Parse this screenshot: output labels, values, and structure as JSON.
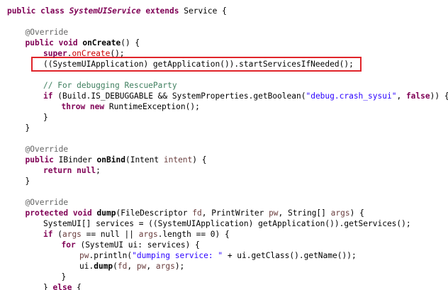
{
  "editor": {
    "language": "java",
    "colors": {
      "keyword": "#7f0055",
      "annotation": "#646464",
      "string": "#2a00ff",
      "comment": "#3f7f5f",
      "local_variable": "#6a3e3e",
      "highlight_box": "#e0242a"
    },
    "lines": [
      {
        "id": "l1",
        "indent": 0,
        "tokens": [
          {
            "t": "public class ",
            "c": "kw"
          },
          {
            "t": "SystemUIService",
            "c": "cls"
          },
          {
            "t": " extends ",
            "c": "kw"
          },
          {
            "t": "Service {",
            "c": "plain"
          }
        ]
      },
      {
        "id": "l3",
        "indent": 1,
        "tokens": [
          {
            "t": "@Override",
            "c": "ann"
          }
        ]
      },
      {
        "id": "l4",
        "indent": 1,
        "tokens": [
          {
            "t": "public void ",
            "c": "kw"
          },
          {
            "t": "onCreate",
            "c": "fn"
          },
          {
            "t": "() {",
            "c": "plain"
          }
        ]
      },
      {
        "id": "l5",
        "indent": 2,
        "tokens": [
          {
            "t": "super",
            "c": "kw"
          },
          {
            "t": ".",
            "c": "plain"
          },
          {
            "t": "onCreate",
            "c": "red"
          },
          {
            "t": "();",
            "c": "plain"
          }
        ]
      },
      {
        "id": "l6",
        "indent": 2,
        "tokens": [
          {
            "t": "((SystemUIApplication) getApplication()).startServicesIfNeeded();",
            "c": "plain"
          }
        ]
      },
      {
        "id": "l8",
        "indent": 2,
        "tokens": [
          {
            "t": "// For debugging RescueParty",
            "c": "cmt"
          }
        ]
      },
      {
        "id": "l9",
        "indent": 2,
        "tokens": [
          {
            "t": "if ",
            "c": "kw"
          },
          {
            "t": "(Build.IS_DEBUGGABLE && SystemProperties.getBoolean(",
            "c": "plain"
          },
          {
            "t": "\"debug.crash_sysui\"",
            "c": "str"
          },
          {
            "t": ", ",
            "c": "plain"
          },
          {
            "t": "false",
            "c": "kw"
          },
          {
            "t": ")) {",
            "c": "plain"
          }
        ]
      },
      {
        "id": "l10",
        "indent": 3,
        "tokens": [
          {
            "t": "throw new ",
            "c": "kw"
          },
          {
            "t": "RuntimeException();",
            "c": "plain"
          }
        ]
      },
      {
        "id": "l11",
        "indent": 2,
        "tokens": [
          {
            "t": "}",
            "c": "plain"
          }
        ]
      },
      {
        "id": "l12",
        "indent": 1,
        "tokens": [
          {
            "t": "}",
            "c": "plain"
          }
        ]
      },
      {
        "id": "l14",
        "indent": 1,
        "tokens": [
          {
            "t": "@Override",
            "c": "ann"
          }
        ]
      },
      {
        "id": "l15",
        "indent": 1,
        "tokens": [
          {
            "t": "public ",
            "c": "kw"
          },
          {
            "t": "IBinder ",
            "c": "plain"
          },
          {
            "t": "onBind",
            "c": "fn"
          },
          {
            "t": "(Intent ",
            "c": "plain"
          },
          {
            "t": "intent",
            "c": "var"
          },
          {
            "t": ") {",
            "c": "plain"
          }
        ]
      },
      {
        "id": "l16",
        "indent": 2,
        "tokens": [
          {
            "t": "return null",
            "c": "kw"
          },
          {
            "t": ";",
            "c": "plain"
          }
        ]
      },
      {
        "id": "l17",
        "indent": 1,
        "tokens": [
          {
            "t": "}",
            "c": "plain"
          }
        ]
      },
      {
        "id": "l19",
        "indent": 1,
        "tokens": [
          {
            "t": "@Override",
            "c": "ann"
          }
        ]
      },
      {
        "id": "l20",
        "indent": 1,
        "tokens": [
          {
            "t": "protected void ",
            "c": "kw"
          },
          {
            "t": "dump",
            "c": "fn"
          },
          {
            "t": "(FileDescriptor ",
            "c": "plain"
          },
          {
            "t": "fd",
            "c": "var"
          },
          {
            "t": ", PrintWriter ",
            "c": "plain"
          },
          {
            "t": "pw",
            "c": "var"
          },
          {
            "t": ", String[] ",
            "c": "plain"
          },
          {
            "t": "args",
            "c": "var"
          },
          {
            "t": ") {",
            "c": "plain"
          }
        ]
      },
      {
        "id": "l21",
        "indent": 2,
        "tokens": [
          {
            "t": "SystemUI[] services = ((SystemUIApplication) getApplication()).getServices();",
            "c": "plain"
          }
        ]
      },
      {
        "id": "l22",
        "indent": 2,
        "tokens": [
          {
            "t": "if ",
            "c": "kw"
          },
          {
            "t": "(",
            "c": "plain"
          },
          {
            "t": "args",
            "c": "var"
          },
          {
            "t": " == null || ",
            "c": "plain"
          },
          {
            "t": "args",
            "c": "var"
          },
          {
            "t": ".length == 0) {",
            "c": "plain"
          }
        ]
      },
      {
        "id": "l23",
        "indent": 3,
        "tokens": [
          {
            "t": "for ",
            "c": "kw"
          },
          {
            "t": "(SystemUI ui: services) {",
            "c": "plain"
          }
        ]
      },
      {
        "id": "l24",
        "indent": 4,
        "tokens": [
          {
            "t": "pw",
            "c": "var"
          },
          {
            "t": ".println(",
            "c": "plain"
          },
          {
            "t": "\"dumping service: \"",
            "c": "str"
          },
          {
            "t": " + ui.getClass().getName());",
            "c": "plain"
          }
        ]
      },
      {
        "id": "l25",
        "indent": 4,
        "tokens": [
          {
            "t": "ui.",
            "c": "plain"
          },
          {
            "t": "dump",
            "c": "fn"
          },
          {
            "t": "(",
            "c": "plain"
          },
          {
            "t": "fd",
            "c": "var"
          },
          {
            "t": ", ",
            "c": "plain"
          },
          {
            "t": "pw",
            "c": "var"
          },
          {
            "t": ", ",
            "c": "plain"
          },
          {
            "t": "args",
            "c": "var"
          },
          {
            "t": ");",
            "c": "plain"
          }
        ]
      },
      {
        "id": "l26",
        "indent": 3,
        "tokens": [
          {
            "t": "}",
            "c": "plain"
          }
        ]
      },
      {
        "id": "l27",
        "indent": 2,
        "tokens": [
          {
            "t": "} ",
            "c": "plain"
          },
          {
            "t": "else",
            "c": "kw"
          },
          {
            "t": " {",
            "c": "plain"
          }
        ]
      }
    ]
  }
}
